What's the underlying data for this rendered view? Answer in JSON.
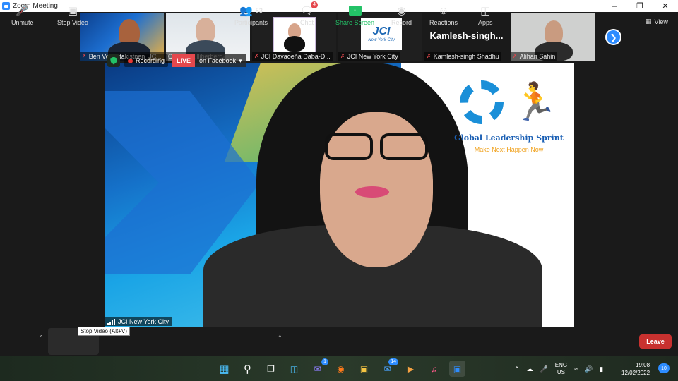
{
  "window": {
    "title": "Zoom Meeting",
    "controls": [
      "minimize",
      "maximize",
      "close"
    ]
  },
  "gallery": {
    "tiles": [
      {
        "name": "Ben Venkatakistnen_JC...",
        "muted": true
      },
      {
        "name": "Cristian Zilliberberg",
        "muted": false
      },
      {
        "name": "JCI Davaoeña Daba-D...",
        "muted": true
      },
      {
        "name": "JCI New York City",
        "muted": true,
        "card_title": "JCI",
        "card_sub": "New York City"
      },
      {
        "name": "Kamlesh-singh Shadhu",
        "muted": true,
        "big_label": "Kamlesh-singh..."
      },
      {
        "name": "Alihan Sahin",
        "muted": true
      }
    ],
    "view_label": "View"
  },
  "main_video": {
    "speaker": "JCI New York City",
    "recording_label": "Recording",
    "live_label": "LIVE",
    "live_platform": "on Facebook",
    "logo_title": "Global Leadership Sprint",
    "logo_tagline": "Make Next Happen Now"
  },
  "tooltip": "Stop Video (Alt+V)",
  "toolbar": {
    "unmute": "Unmute",
    "stop_video": "Stop Video",
    "participants": "Participants",
    "participants_count": "53",
    "chat": "Chat",
    "chat_badge": "4",
    "share_screen": "Share Screen",
    "record": "Record",
    "reactions": "Reactions",
    "apps": "Apps",
    "leave": "Leave"
  },
  "taskbar": {
    "teams_badge": "1",
    "mail_badge": "14",
    "lang_top": "ENG",
    "lang_bottom": "US",
    "time": "19:08",
    "date": "12/02/2022",
    "notifications": "10"
  }
}
